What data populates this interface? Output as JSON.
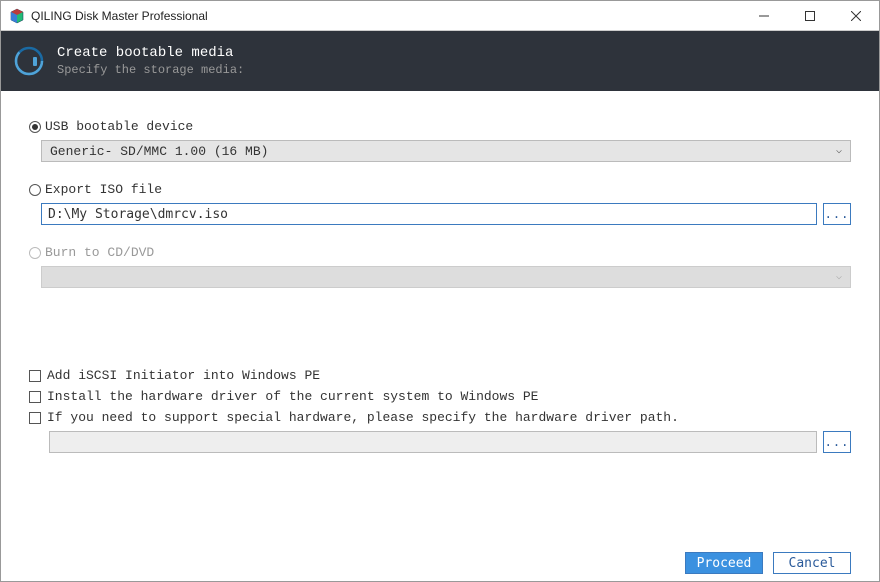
{
  "window": {
    "title": "QILING Disk Master Professional"
  },
  "banner": {
    "title": "Create bootable media",
    "subtitle": "Specify the storage media:"
  },
  "options": {
    "usb": {
      "label": "USB bootable device",
      "selected": true,
      "device": "Generic- SD/MMC 1.00 (16 MB)"
    },
    "iso": {
      "label": "Export ISO file",
      "selected": false,
      "path": "D:\\My Storage\\dmrcv.iso",
      "browse": "..."
    },
    "cddvd": {
      "label": "Burn to CD/DVD",
      "selected": false,
      "disabled": true,
      "device": ""
    }
  },
  "checkboxes": {
    "iscsi": "Add iSCSI Initiator into Windows PE",
    "driver": "Install the hardware driver of the current system to Windows PE",
    "special": "If you need to support special hardware, please specify the hardware driver path."
  },
  "driver_path": {
    "value": "",
    "browse": "..."
  },
  "buttons": {
    "proceed": "Proceed",
    "cancel": "Cancel"
  }
}
